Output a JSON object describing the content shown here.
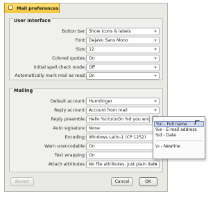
{
  "window": {
    "title": "Mail preferences"
  },
  "user_interface": {
    "title": "User interface",
    "fields": [
      {
        "label": "Button bar:",
        "value": "Show icons & labels"
      },
      {
        "label": "Font:",
        "value": "DejaVu Sans Mono"
      },
      {
        "label": "Size:",
        "value": "12"
      },
      {
        "label": "Colored quotes:",
        "value": "On"
      },
      {
        "label": "Initial spell check mode:",
        "value": "Off"
      },
      {
        "label": "Automatically mark mail as read:",
        "value": "On"
      }
    ]
  },
  "mailing": {
    "title": "Mailing",
    "fields": [
      {
        "label": "Default account:",
        "value": "Humdinger"
      },
      {
        "label": "Reply account:",
        "value": "Account from mail"
      },
      {
        "label": "Reply preamble:",
        "value": "Hello %n!\\n\\nOn %d you wrot"
      },
      {
        "label": "Auto signature:",
        "value": "None"
      },
      {
        "label": "Encoding:",
        "value": "Windows Latin-1 (CP 1252)"
      },
      {
        "label": "Warn unencodable:",
        "value": "On"
      },
      {
        "label": "Text wrapping:",
        "value": "On"
      },
      {
        "label": "Attach attributes:",
        "value": "No file attributes, just plain data"
      }
    ]
  },
  "preamble_menu": {
    "items": [
      "%n - Full name",
      "%e - E-mail address",
      "%d - Date",
      "\\n - Newline"
    ]
  },
  "buttons": {
    "revert": "Revert",
    "cancel": "Cancel",
    "ok": "OK"
  }
}
